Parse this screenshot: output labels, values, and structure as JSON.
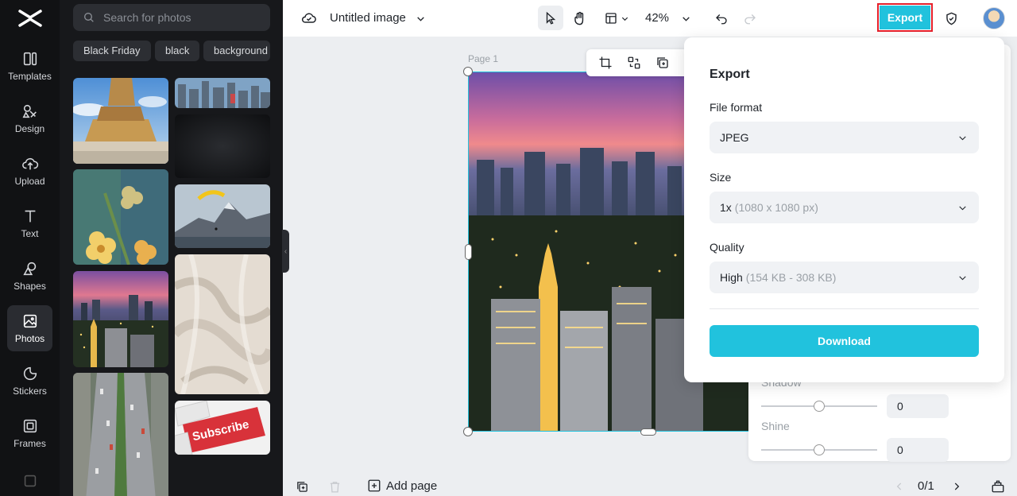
{
  "rail": {
    "items": [
      {
        "label": "Templates",
        "icon": "templates-icon"
      },
      {
        "label": "Design",
        "icon": "design-icon"
      },
      {
        "label": "Upload",
        "icon": "upload-icon"
      },
      {
        "label": "Text",
        "icon": "text-icon"
      },
      {
        "label": "Shapes",
        "icon": "shapes-icon"
      },
      {
        "label": "Photos",
        "icon": "photos-icon"
      },
      {
        "label": "Stickers",
        "icon": "stickers-icon"
      },
      {
        "label": "Frames",
        "icon": "frames-icon"
      }
    ],
    "active": "Photos"
  },
  "panel": {
    "search_placeholder": "Search for photos",
    "chips": [
      "Black Friday",
      "black",
      "background"
    ]
  },
  "topbar": {
    "title": "Untitled image",
    "zoom": "42%",
    "export_label": "Export"
  },
  "canvas": {
    "page_label": "Page 1"
  },
  "props": {
    "shadow_label": "Shadow",
    "shadow_value": "0",
    "shine_label": "Shine",
    "shine_value": "0"
  },
  "export_popover": {
    "title": "Export",
    "file_format_label": "File format",
    "file_format_value": "JPEG",
    "size_label": "Size",
    "size_value": "1x",
    "size_hint": "(1080 x 1080 px)",
    "quality_label": "Quality",
    "quality_value": "High",
    "quality_hint": "(154 KB - 308 KB)",
    "download_label": "Download"
  },
  "bottombar": {
    "add_page_label": "Add page",
    "page_count": "0/1"
  },
  "colors": {
    "accent": "#21c2dd",
    "highlight_outline": "#e6202b",
    "rail_bg": "#111214",
    "panel_bg": "#17181b"
  }
}
